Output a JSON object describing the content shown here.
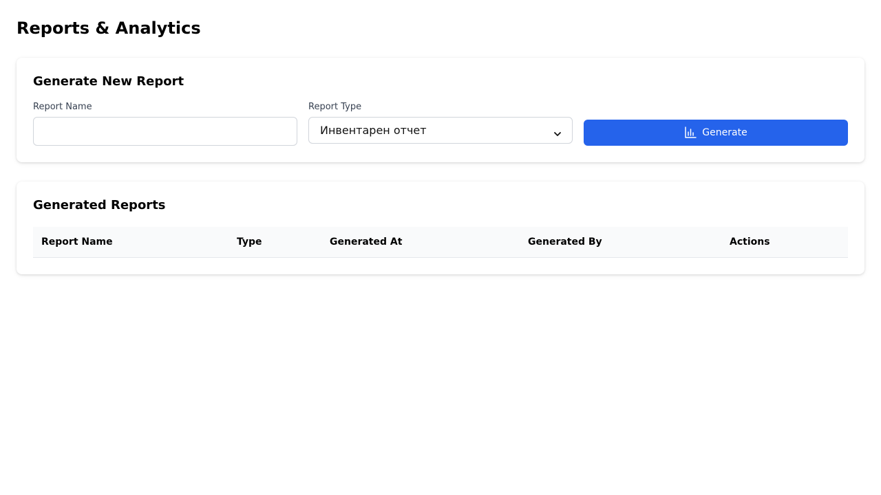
{
  "page": {
    "title": "Reports & Analytics"
  },
  "generate": {
    "title": "Generate New Report",
    "report_name_label": "Report Name",
    "report_name_value": "",
    "report_name_placeholder": "",
    "report_type_label": "Report Type",
    "report_type_selected": "Инвентарен отчет",
    "button_label": "Generate",
    "button_icon": "bar-chart-icon",
    "accent_color": "#2563eb"
  },
  "reports": {
    "title": "Generated Reports",
    "columns": [
      "Report Name",
      "Type",
      "Generated At",
      "Generated By",
      "Actions"
    ],
    "rows": []
  }
}
